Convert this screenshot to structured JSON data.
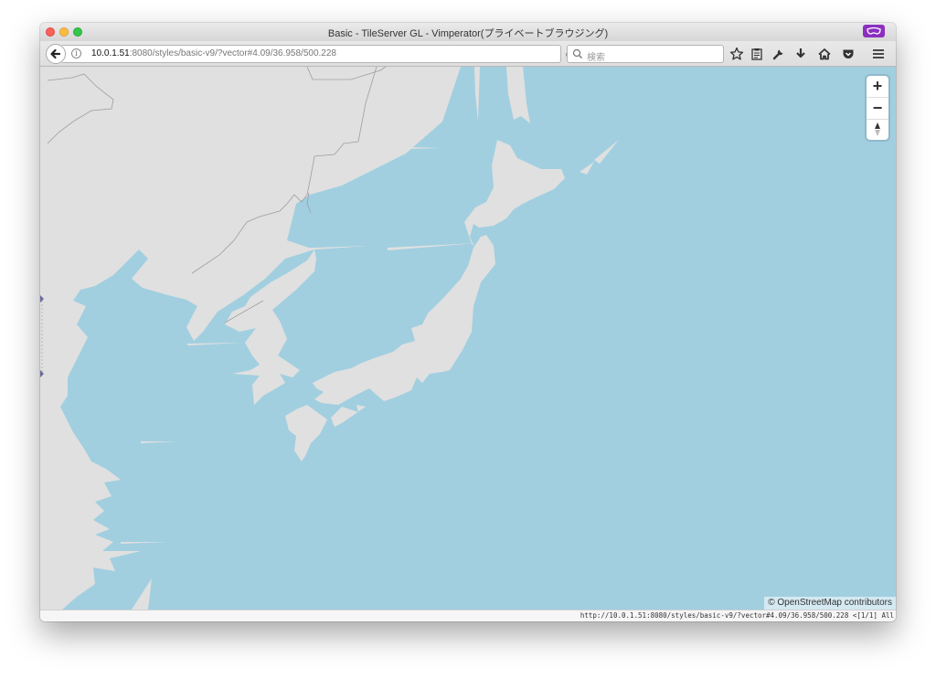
{
  "window": {
    "title": "Basic - TileServer GL - Vimperator(プライベートブラウジング)"
  },
  "toolbar": {
    "url_host": "10.0.1.51",
    "url_rest": ":8080/styles/basic-v9/?vector#4.09/36.958/500.228",
    "search_placeholder": "検索"
  },
  "map": {
    "zoom_in_label": "+",
    "zoom_out_label": "−",
    "attribution": "© OpenStreetMap contributors",
    "colors": {
      "water": "#a1cfe0",
      "land": "#e0e0e0",
      "border": "#9e9e9e"
    }
  },
  "statusbar": {
    "text": "http://10.0.1.51:8080/styles/basic-v9/?vector#4.09/36.958/500.228 <[1/1] All"
  },
  "icons": [
    "back-arrow-icon",
    "info-icon",
    "reload-icon",
    "search-icon",
    "bookmark-star-icon",
    "reading-list-icon",
    "wrench-icon",
    "download-icon",
    "home-icon",
    "pocket-icon",
    "menu-icon",
    "compass-icon",
    "private-mask-icon"
  ]
}
